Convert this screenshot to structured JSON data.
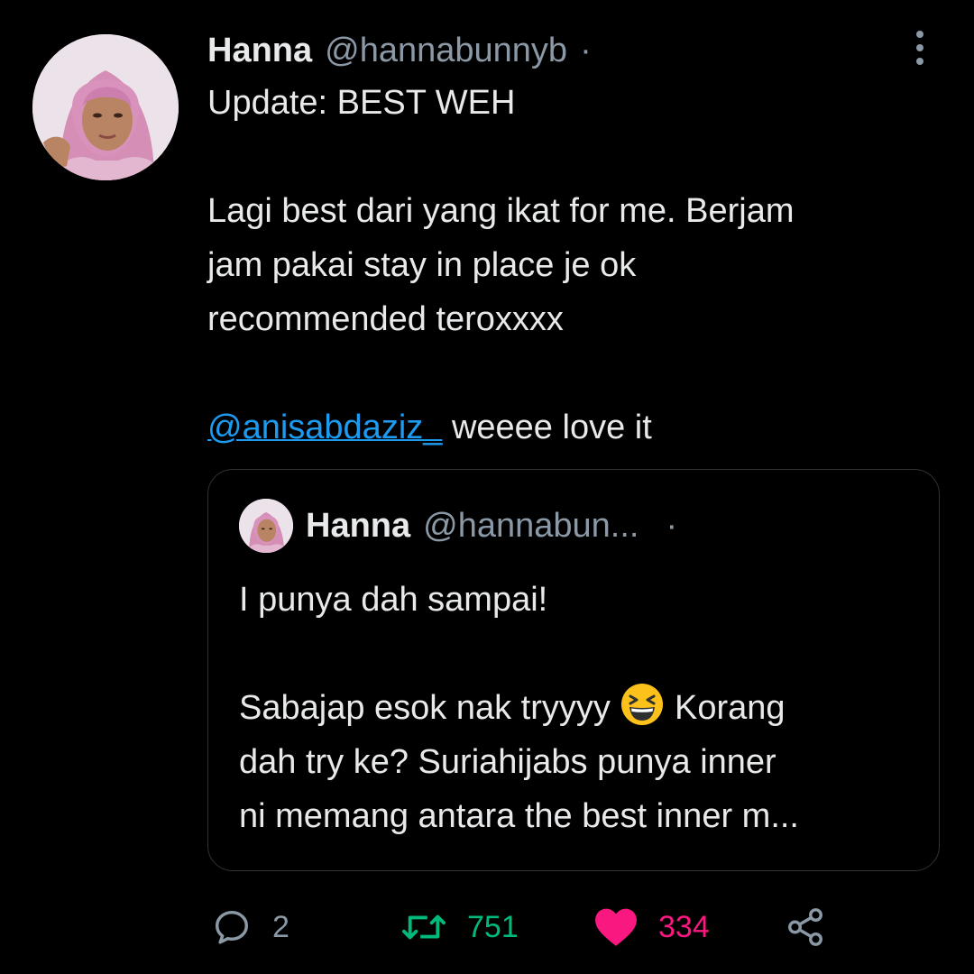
{
  "tweet": {
    "author_name": "Hanna",
    "author_handle": "@hannabunnyb",
    "separator": "·",
    "lines": [
      "Update: BEST WEH",
      "Lagi best dari yang ikat for me. Berjam",
      "jam pakai stay in place je ok",
      "recommended teroxxxx"
    ],
    "mention": "@anisabdaziz_",
    "mention_suffix": " weeee love it"
  },
  "quoted_tweet": {
    "author_name": "Hanna",
    "author_handle": "@hannabun...",
    "separator": "·",
    "line1": "I punya dah sampai!",
    "line2_before_emoji": "Sabajap esok nak tryyyy ",
    "emoji": "grinning-squinting-face",
    "line2_after_emoji": " Korang",
    "line3": "dah try ke? Suriahijabs punya inner",
    "line4": "ni memang antara the best inner m..."
  },
  "actions": {
    "reply_count": "2",
    "retweet_count": "751",
    "like_count": "334",
    "reply_icon": "reply-icon",
    "retweet_icon": "retweet-icon",
    "like_icon": "heart-icon",
    "share_icon": "share-icon"
  },
  "colors": {
    "background": "#000000",
    "text": "#e7e9ea",
    "secondary": "#8b98a5",
    "link": "#1d9bf0",
    "retweet": "#00ba7c",
    "like": "#f91880",
    "border": "#2f3336"
  }
}
